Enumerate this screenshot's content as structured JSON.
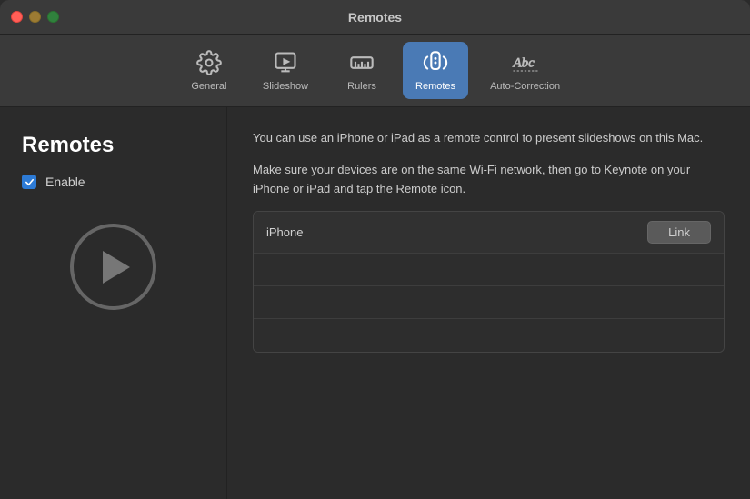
{
  "titlebar": {
    "title": "Remotes"
  },
  "tabs": [
    {
      "id": "general",
      "label": "General",
      "icon": "gear",
      "active": false
    },
    {
      "id": "slideshow",
      "label": "Slideshow",
      "icon": "play",
      "active": false
    },
    {
      "id": "rulers",
      "label": "Rulers",
      "icon": "ruler",
      "active": false
    },
    {
      "id": "remotes",
      "label": "Remotes",
      "icon": "remote",
      "active": true
    },
    {
      "id": "autocorrection",
      "label": "Auto-Correction",
      "icon": "abc",
      "active": false
    }
  ],
  "sidebar": {
    "title": "Remotes",
    "enable_label": "Enable",
    "enable_checked": true
  },
  "main": {
    "description1": "You can use an iPhone or iPad as a remote control to present slideshows on this Mac.",
    "description2": "Make sure your devices are on the same Wi-Fi network, then go to Keynote on your iPhone or iPad and tap the Remote icon.",
    "devices": [
      {
        "name": "iPhone",
        "action": "Link",
        "empty": false
      },
      {
        "name": "",
        "action": "",
        "empty": true
      },
      {
        "name": "",
        "action": "",
        "empty": true
      },
      {
        "name": "",
        "action": "",
        "empty": true
      }
    ],
    "link_button_label": "Link"
  }
}
